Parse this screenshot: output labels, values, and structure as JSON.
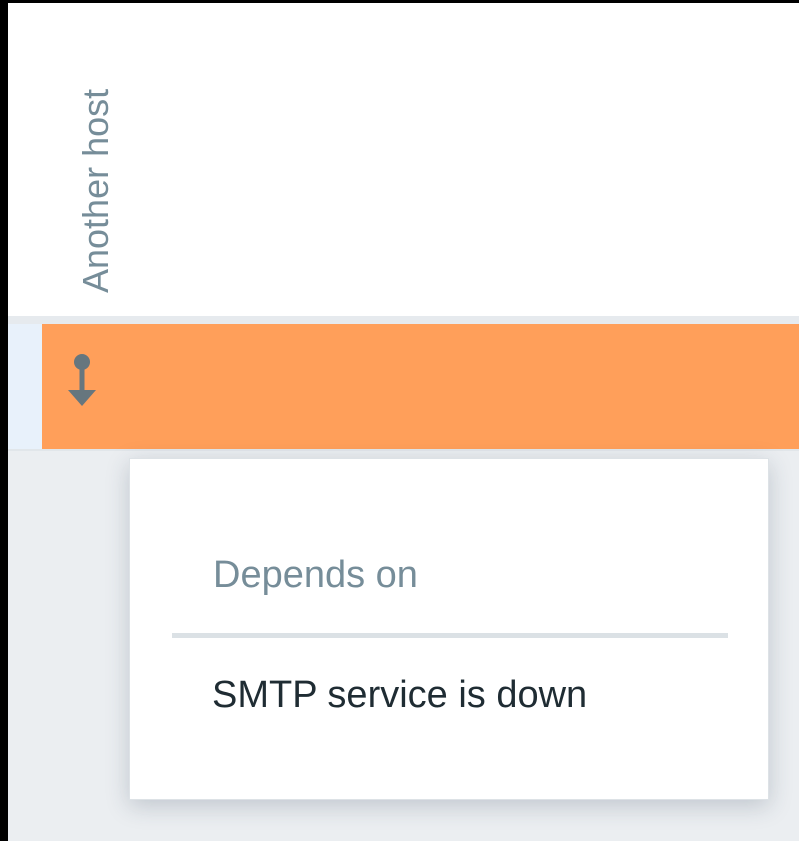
{
  "host_column": {
    "label": "Another host"
  },
  "problem_row": {
    "severity_color": "#ff9f5a",
    "icon": "dependency-arrow-down-icon"
  },
  "dependency_popup": {
    "title": "Depends on",
    "items": [
      {
        "label": "SMTP service is down"
      }
    ]
  },
  "colors": {
    "muted_text": "#768d99",
    "primary_text": "#1f2c33",
    "panel_background": "#ebeef1"
  }
}
